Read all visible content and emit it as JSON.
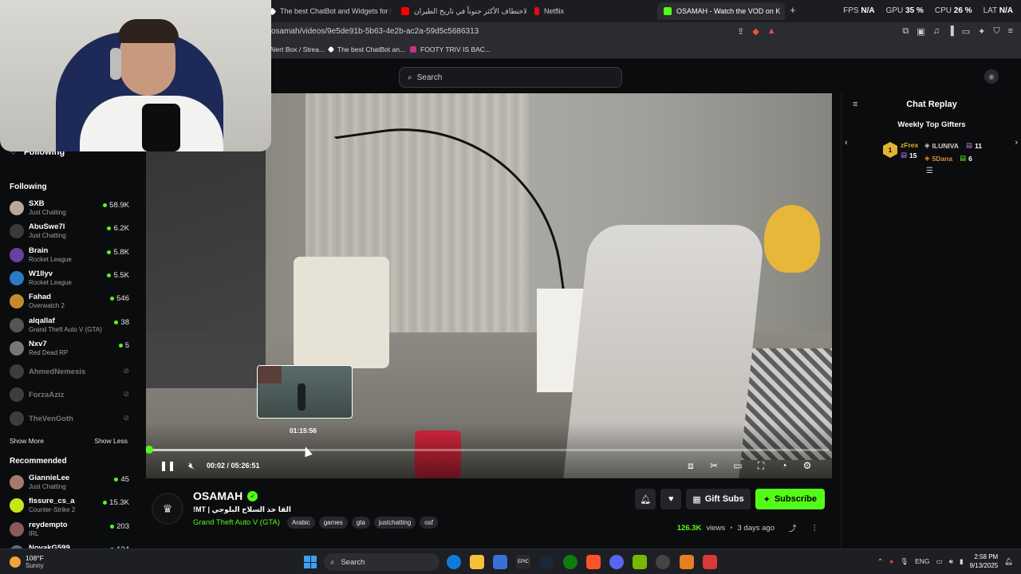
{
  "browser": {
    "tabs": [
      {
        "label": "The best ChatBot and Widgets for Ki",
        "color": "#ffffff",
        "active": false
      },
      {
        "label": "الاختطاف الأكثر جنوناً في تاريخ الطيران",
        "color": "#ff0000",
        "active": false
      },
      {
        "label": "Netflix",
        "color": "#e50914",
        "active": false
      },
      {
        "label": "OSAMAH - Watch the VOD on K",
        "color": "#53fc18",
        "active": true
      }
    ],
    "close_icon": "close-icon",
    "new_tab": "+",
    "url": "osamah/videos/9e5de91b-5b63-4e2b-ac2a-59d5c5686313",
    "stats": [
      {
        "label": "FPS",
        "value": "N/A"
      },
      {
        "label": "GPU",
        "value": "35 %"
      },
      {
        "label": "CPU",
        "value": "26 %"
      },
      {
        "label": "LAT",
        "value": "N/A"
      }
    ],
    "bookmarks": [
      {
        "label": "Alert Box / Strea...",
        "color": "#3a86ff"
      },
      {
        "label": "The best ChatBot an...",
        "color": "#ffffff"
      },
      {
        "label": "FOOTY TRIV IS BAC...",
        "color": "#c13584"
      }
    ]
  },
  "page": {
    "search_placeholder": "Search",
    "sidebar": {
      "following_label": "Following",
      "following_title": "Following",
      "following": [
        {
          "name": "SXB",
          "category": "Just Chatting",
          "viewers": "58.9K",
          "color": "#b8a8a0",
          "live": true
        },
        {
          "name": "AbuSwe7l",
          "category": "Just Chatting",
          "viewers": "6.2K",
          "color": "#3a3a3a",
          "live": true
        },
        {
          "name": "Brain",
          "category": "Rocket League",
          "viewers": "5.8K",
          "color": "#6b3fa0",
          "live": true
        },
        {
          "name": "W1llyv",
          "category": "Rocket League",
          "viewers": "5.5K",
          "color": "#2a7bc4",
          "live": true
        },
        {
          "name": "Fahad",
          "category": "Overwatch 2",
          "viewers": "546",
          "color": "#c28b2a",
          "live": true
        },
        {
          "name": "alqallaf",
          "category": "Grand Theft Auto V (GTA)",
          "viewers": "38",
          "color": "#555555",
          "live": true
        },
        {
          "name": "Nxv7",
          "category": "Red Dead RP",
          "viewers": "5",
          "color": "#777777",
          "live": true
        },
        {
          "name": "AhmedNemesis",
          "category": "",
          "viewers": "",
          "color": "#888888",
          "live": false
        },
        {
          "name": "ForzaAziz",
          "category": "",
          "viewers": "",
          "color": "#888888",
          "live": false
        },
        {
          "name": "TheVenGoth",
          "category": "",
          "viewers": "",
          "color": "#888888",
          "live": false
        }
      ],
      "show_more": "Show More",
      "show_less": "Show Less",
      "recommended_title": "Recommended",
      "recommended": [
        {
          "name": "GiannieLee",
          "category": "Just Chatting",
          "viewers": "45",
          "color": "#a47b6a",
          "live": true
        },
        {
          "name": "fissure_cs_a",
          "category": "Counter-Strike 2",
          "viewers": "15.3K",
          "color": "#c8e617",
          "live": true
        },
        {
          "name": "reydempto",
          "category": "IRL",
          "viewers": "203",
          "color": "#8a5a5a",
          "live": true
        },
        {
          "name": "NovakG599",
          "category": "",
          "viewers": "134",
          "color": "#5a6a8a",
          "live": true
        }
      ]
    },
    "player": {
      "preview_time": "01:15:56",
      "time": "00:02 / 05:26:51",
      "progress_fraction": 0.0001,
      "hover_fraction": 0.232
    },
    "chat": {
      "title": "Chat Replay",
      "gifters_title": "Weekly Top Gifters",
      "rank": "1",
      "gifters": [
        {
          "name": "zFrex",
          "count": "15",
          "color": "#e3b230"
        },
        {
          "name": "ILUNIVA",
          "count": "11",
          "color": "#cfcfcf"
        },
        {
          "name": "5Dana",
          "count": "6",
          "color": "#e08a3c"
        }
      ]
    },
    "stream": {
      "channel": "OSAMAH",
      "title": "!MT | القا خذ السلاح البلوجي",
      "category": "Grand Theft Auto V (GTA)",
      "tags": [
        "Arabic",
        "games",
        "gta",
        "justchatting",
        "osf"
      ],
      "gift_subs": "Gift Subs",
      "subscribe": "Subscribe",
      "views": "126.3K",
      "views_label": "views",
      "ago": "3 days ago"
    }
  },
  "taskbar": {
    "temp": "108°F",
    "condition": "Sunny",
    "search": "Search",
    "lang": "ENG",
    "time": "2:58 PM",
    "date": "9/13/2025"
  }
}
